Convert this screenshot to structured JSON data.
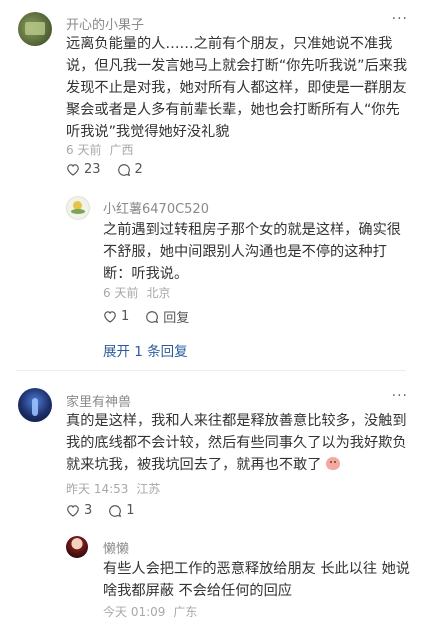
{
  "comments": [
    {
      "author": "开心的小果子",
      "text": "远离负能量的人……之前有个朋友，只准她说不准我说，但凡我一发言她马上就会打断“你先听我说”后来我发现不止是对我，她对所有人都这样，即使是一群朋友聚会或者是人多有前辈长辈，她也会打断所有人“你先听我说”我觉得她好没礼貌",
      "time": "6 天前",
      "location": "广西",
      "likes": "23",
      "replies_count": "2",
      "reply": {
        "author": "小红薯6470C520",
        "text": "之前遇到过转租房子那个女的就是这样，确实很不舒服，她中间跟别人沟通也是不停的这种打断：听我说。",
        "time": "6 天前",
        "location": "北京",
        "likes": "1",
        "reply_label": "回复"
      },
      "expand": "展开 1 条回复"
    },
    {
      "author": "家里有神兽",
      "text": "真的是这样，我和人来往都是释放善意比较多，没触到我的底线都不会计较，然后有些同事久了以为我好欺负就来坑我，被我坑回去了，就再也不敢了",
      "time": "昨天 14:53",
      "location": "江苏",
      "likes": "3",
      "replies_count": "1",
      "reply": {
        "author": "懒懒",
        "text": "有些人会把工作的恶意释放给朋友 长此以往 她说啥我都屏蔽 不会给任何的回应",
        "time": "今天 01:09",
        "location": "广东"
      }
    }
  ],
  "more_label": "···",
  "icons": {
    "like": "heart-icon",
    "comment": "comment-icon",
    "emoji": "pig-emoji-icon"
  }
}
